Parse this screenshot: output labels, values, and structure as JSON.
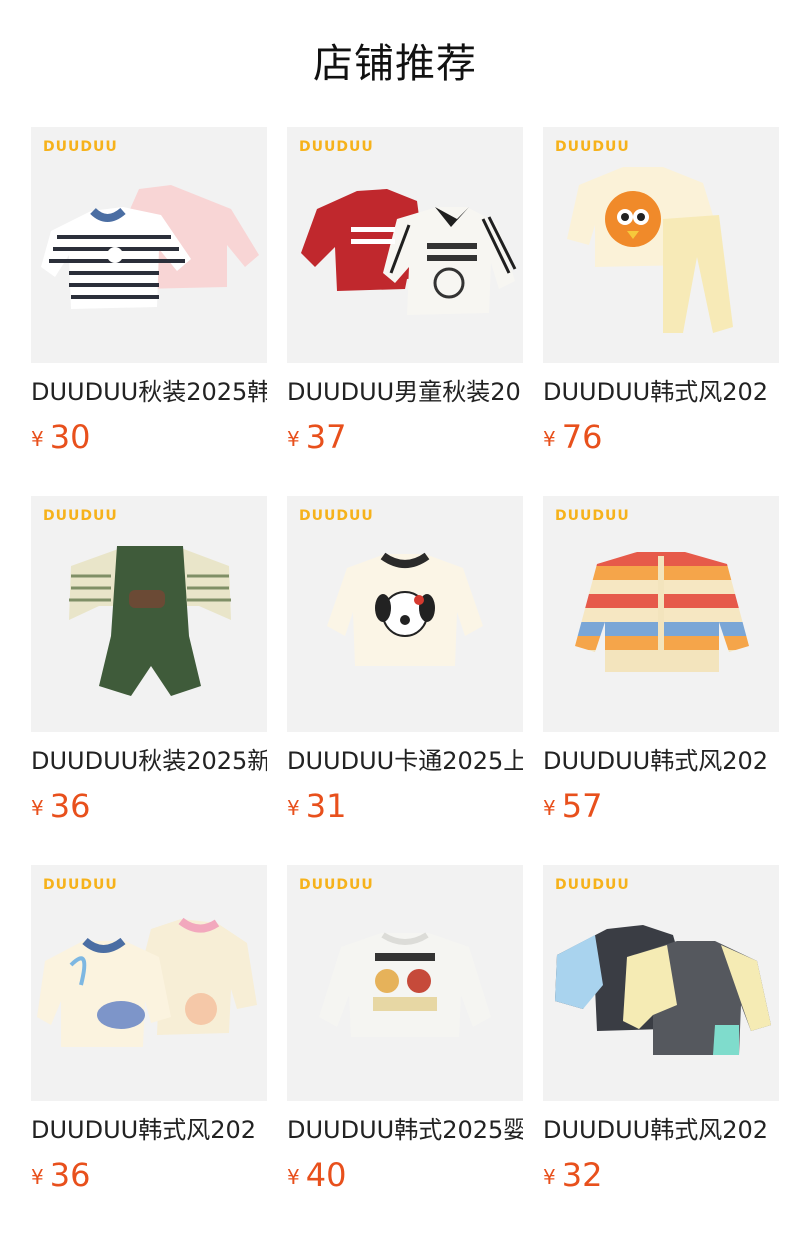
{
  "header": {
    "title": "店铺推荐"
  },
  "brand_mark": "DUUDUU",
  "currency": "¥",
  "products": [
    {
      "name": "DUUDUU秋装2025韩",
      "price": "30"
    },
    {
      "name": "DUUDUU男童秋装20",
      "price": "37"
    },
    {
      "name": "DUUDUU韩式风202",
      "price": "76"
    },
    {
      "name": "DUUDUU秋装2025新",
      "price": "36"
    },
    {
      "name": "DUUDUU卡通2025上",
      "price": "31"
    },
    {
      "name": "DUUDUU韩式风202",
      "price": "57"
    },
    {
      "name": "DUUDUU韩式风202",
      "price": "36"
    },
    {
      "name": "DUUDUU韩式2025婴",
      "price": "40"
    },
    {
      "name": "DUUDUU韩式风202",
      "price": "32"
    }
  ]
}
